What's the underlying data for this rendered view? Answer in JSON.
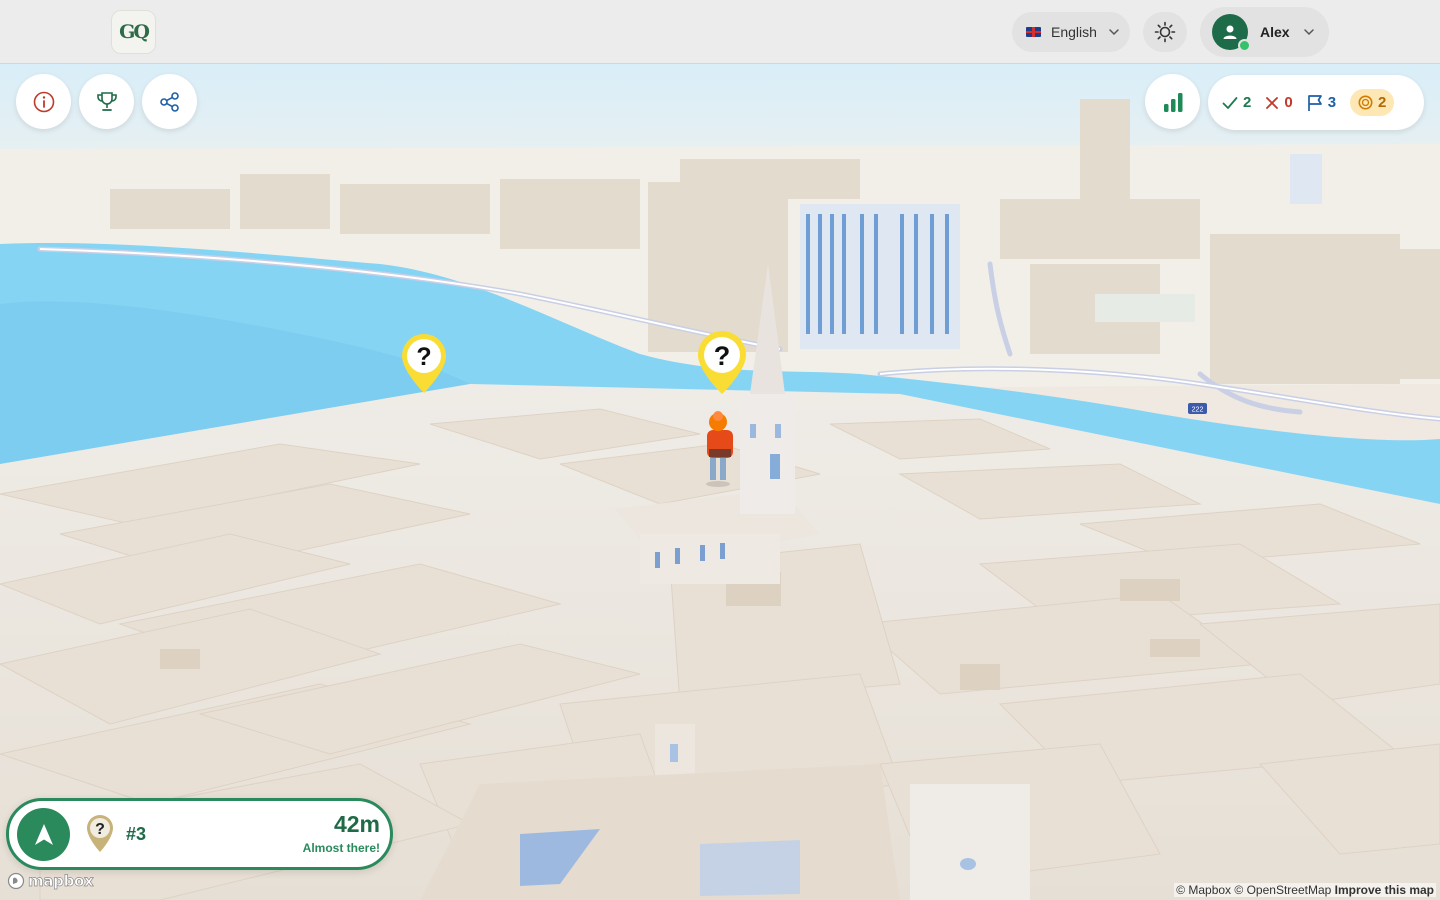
{
  "header": {
    "logo_text": "GQ",
    "language": {
      "flag": "uk-flag",
      "label": "English"
    },
    "theme_toggle_icon": "sun-icon",
    "user": {
      "name": "Alex",
      "status": "online"
    }
  },
  "map_controls": {
    "left": [
      {
        "name": "info-button",
        "icon": "info-icon"
      },
      {
        "name": "trophy-button",
        "icon": "trophy-icon"
      },
      {
        "name": "share-button",
        "icon": "share-icon"
      }
    ],
    "leaderboard_icon": "bar-chart-icon"
  },
  "stats": {
    "correct": "2",
    "wrong": "0",
    "flags": "3",
    "coins": "2"
  },
  "map": {
    "pins": [
      {
        "label": "?",
        "kind": "question-marker"
      },
      {
        "label": "?",
        "kind": "question-marker"
      }
    ],
    "road_label": "222",
    "attribution_mapbox": "© Mapbox",
    "attribution_osm": "© OpenStreetMap",
    "attribution_improve": "Improve this map",
    "logo_text": "mapbox"
  },
  "navigation": {
    "target_label": "?",
    "target_number": "#3",
    "distance": "42m",
    "status": "Almost there!"
  },
  "colors": {
    "brand_green": "#2a8a5c",
    "pin_yellow": "#f9dd34",
    "water": "#7fd3f5",
    "building": "#e7ddd1"
  }
}
